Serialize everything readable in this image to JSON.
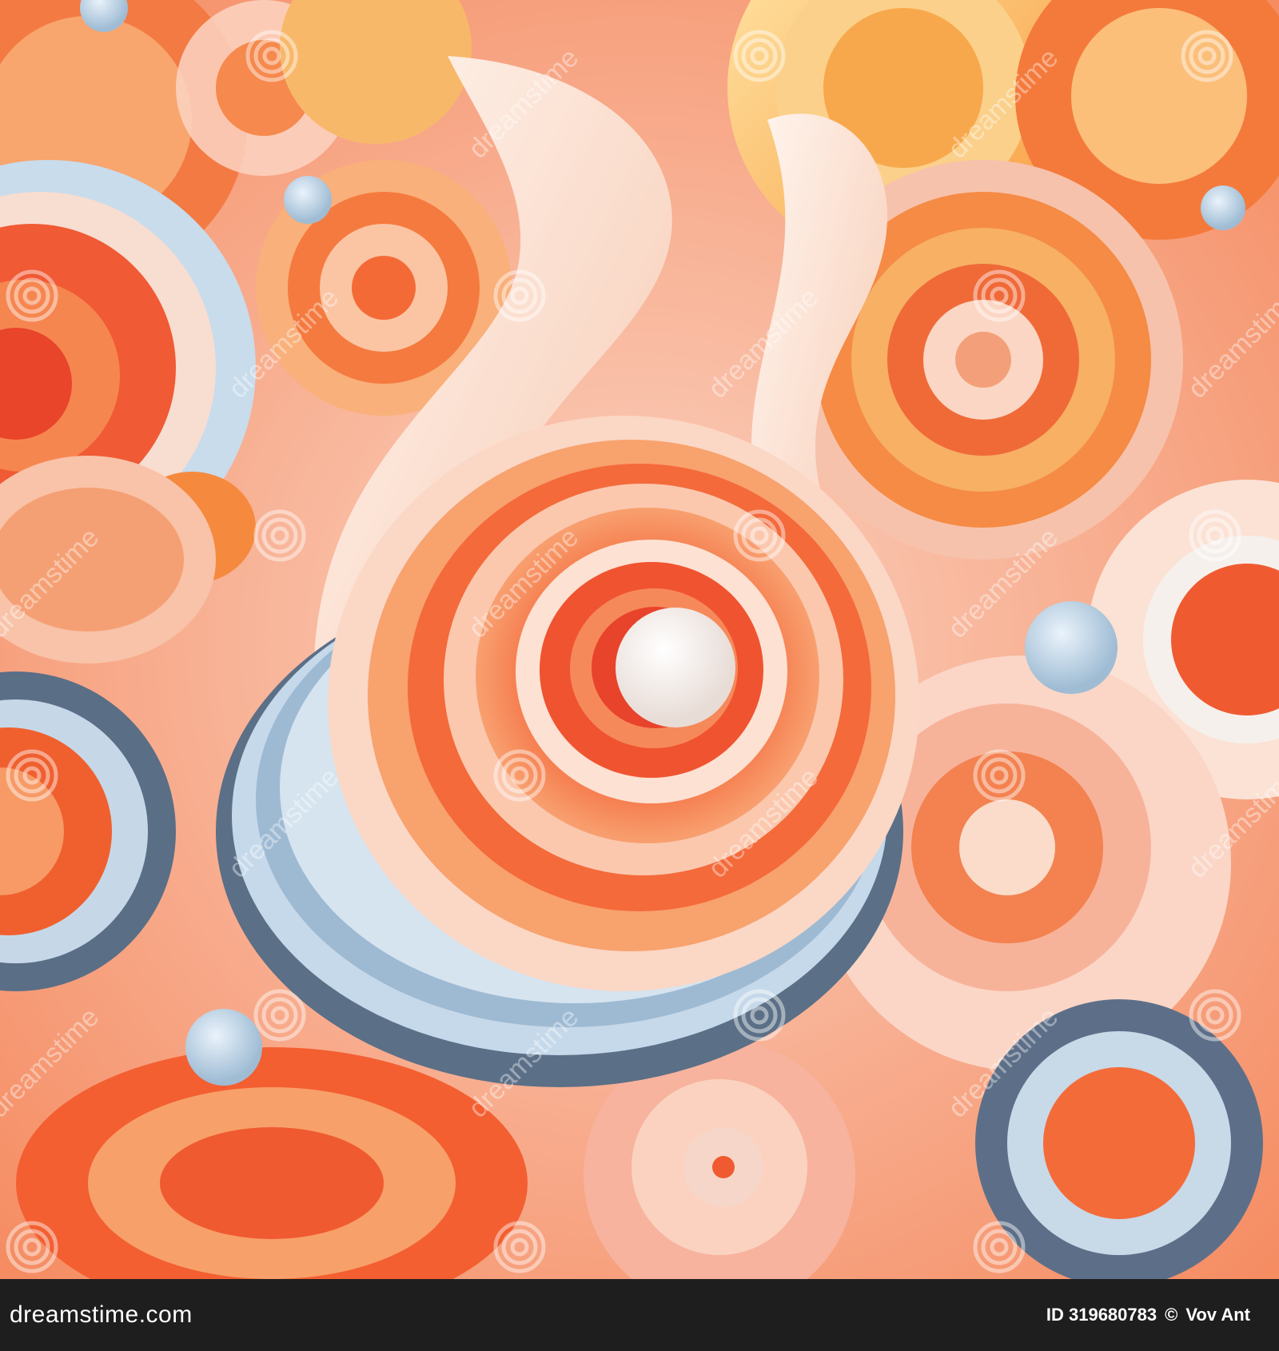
{
  "image": {
    "subject": "abstract layered paper swirls",
    "palette": {
      "coral": "#f0623a",
      "orange": "#f68a3c",
      "peach": "#f7b49a",
      "cream": "#fbeee6",
      "powder_blue": "#c5d8e8",
      "slate_blue": "#5a6e86"
    }
  },
  "watermark": {
    "brand": "dreamstime",
    "icon": "spiral-logo-icon"
  },
  "footer": {
    "site": "dreamstime.com",
    "image_id": "ID 319680783",
    "copyright": "©",
    "author": "Vov Ant"
  }
}
